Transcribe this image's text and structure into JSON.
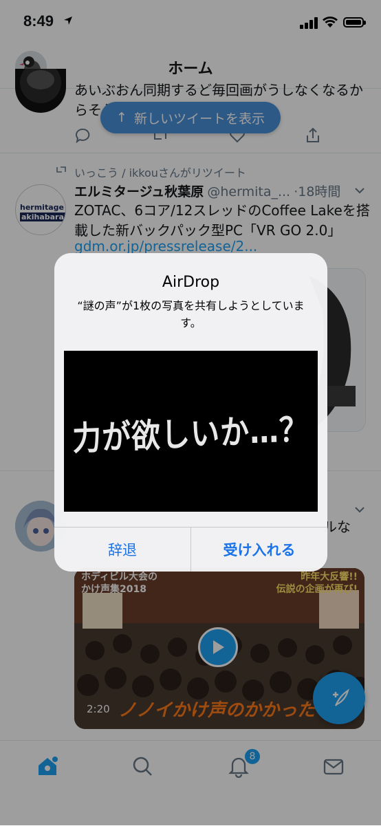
{
  "status_bar": {
    "time": "8:49",
    "location_icon": "location-arrow-icon"
  },
  "header": {
    "title": "ホーム"
  },
  "tweet1": {
    "text_line1": "あいぶおん同期するど毎回画がうしなくなるか",
    "text_line2": "らそう"
  },
  "new_tweets_pill": {
    "label": "新しいツイートを表示",
    "icon": "arrow-up-icon"
  },
  "tweet2": {
    "retweet_label": "いっこう / ikkouさんがリツイート",
    "name": "エルミタージュ秋葉原",
    "handle": "@hermita_...",
    "time": "·18時間",
    "avatar_line1": "hermitage",
    "avatar_line2": "akihabara",
    "text_line1": "ZOTAC、6コア/12スレッドのCoffee Lakeを搭",
    "text_line2": "載した新バックパック型PC「VR GO 2.0」",
    "link": "gdm.or.jp/pressrelease/2..."
  },
  "tweet3": {
    "text_fragment": "ルな",
    "video": {
      "duration": "2:20",
      "caption_top_left_line1": "ホディビル大会の",
      "caption_top_left_line2": "かけ声集2018",
      "caption_top_right_line1": "昨年大反響!!",
      "caption_top_right_line2": "伝説の企画が再び!",
      "caption_bottom": "ノノイかけ声のかかった"
    }
  },
  "airdrop_alert": {
    "title": "AirDrop",
    "message": "“謎の声”が1枚の写真を共有しようとしています。",
    "photo_text": "力が欲しいか…？",
    "decline_label": "辞退",
    "accept_label": "受け入れる"
  },
  "tab_bar": {
    "notifications_badge": "8"
  },
  "colors": {
    "accent": "#1da1f2",
    "alert_button": "#1a73e8",
    "pill": "#4a90d9"
  }
}
